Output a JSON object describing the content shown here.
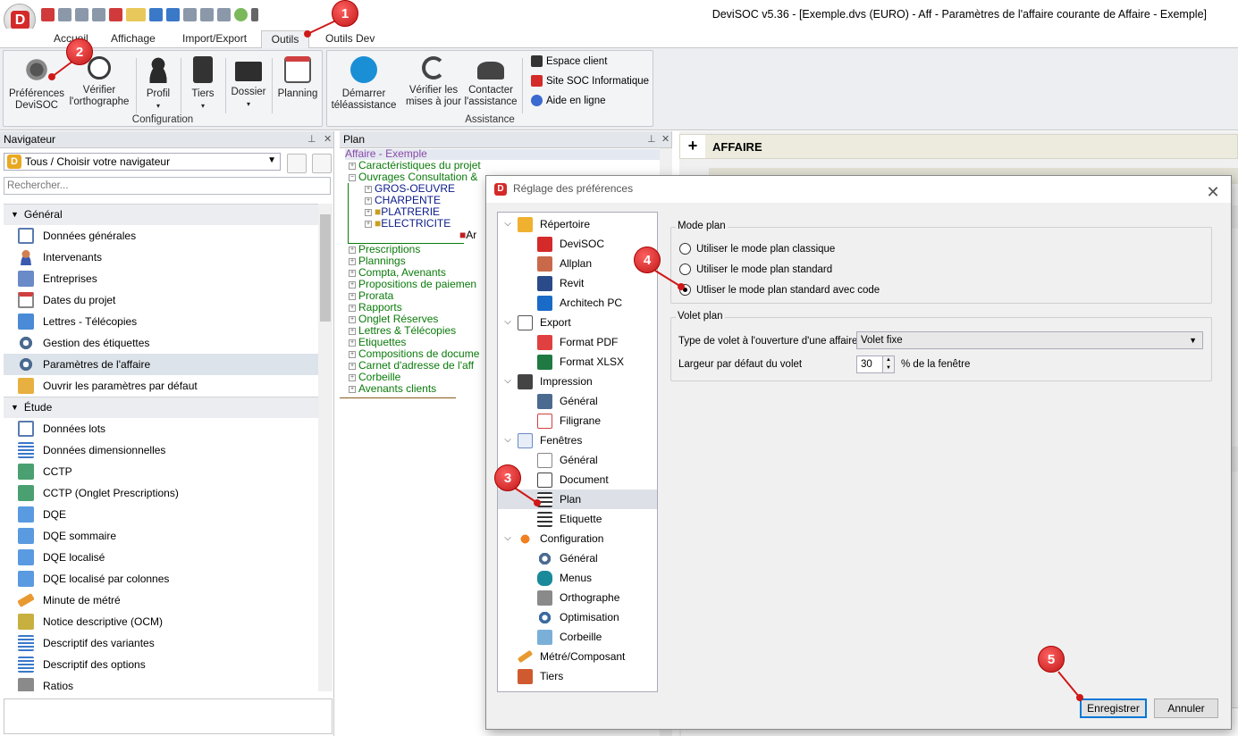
{
  "window": {
    "title": "DeviSOC v5.36 - [Exemple.dvs (EURO) - Aff - Paramètres de l'affaire courante de Affaire - Exemple]",
    "logo": "D"
  },
  "ribbon_tabs": [
    "Accueil",
    "Affichage",
    "Import/Export",
    "Outils",
    "Outils Dev"
  ],
  "active_tab": "Outils",
  "ribbon": {
    "config": {
      "label": "Configuration",
      "buttons": [
        {
          "label": "Préférences\nDeviSOC",
          "icon": "gears-icon"
        },
        {
          "label": "Vérifier\nl'orthographe",
          "icon": "check-icon"
        },
        {
          "label": "Profil",
          "icon": "person-icon"
        },
        {
          "label": "Tiers",
          "icon": "contacts-icon"
        },
        {
          "label": "Dossier",
          "icon": "folder-icon"
        },
        {
          "label": "Planning",
          "icon": "calendar-icon"
        }
      ]
    },
    "assist": {
      "label": "Assistance",
      "buttons": [
        {
          "label": "Démarrer\ntéléassistance",
          "icon": "teamviewer-icon"
        },
        {
          "label": "Vérifier les\nmises à jour",
          "icon": "sync-icon"
        },
        {
          "label": "Contacter\nl'assistance",
          "icon": "phone-icon"
        }
      ]
    },
    "links": [
      "Espace client",
      "Site SOC Informatique",
      "Aide en ligne"
    ]
  },
  "navigator": {
    "title": "Navigateur",
    "selector": "Tous / Choisir votre navigateur",
    "search_placeholder": "Rechercher...",
    "sections": [
      {
        "label": "Général",
        "items": [
          "Données générales",
          "Intervenants",
          "Entreprises",
          "Dates du projet",
          "Lettres - Télécopies",
          "Gestion des étiquettes",
          "Paramètres de l'affaire",
          "Ouvrir les paramètres par défaut"
        ]
      },
      {
        "label": "Étude",
        "items": [
          "Données lots",
          "Données dimensionnelles",
          "CCTP",
          "CCTP (Onglet Prescriptions)",
          "DQE",
          "DQE sommaire",
          "DQE localisé",
          "DQE localisé par colonnes",
          "Minute de métré",
          "Notice descriptive (OCM)",
          "Descriptif des variantes",
          "Descriptif des options",
          "Ratios"
        ]
      }
    ],
    "selected": "Paramètres de l'affaire"
  },
  "plan": {
    "title": "Plan",
    "root": "Affaire - Exemple",
    "items": [
      "Caractéristiques du projet",
      "Ouvrages Consultation &",
      "GROS-OEUVRE",
      "CHARPENTE",
      "PLATRERIE",
      "ELECTRICITE",
      "Ar",
      "Prescriptions",
      "Plannings",
      "Compta, Avenants",
      "Propositions de paiemen",
      "Prorata",
      "Rapports",
      "Onglet Réserves",
      "Lettres & Télécopies",
      "Etiquettes",
      "Compositions de docume",
      "Carnet d'adresse de l'aff",
      "Corbeille",
      "Avenants clients"
    ]
  },
  "right": {
    "header": "AFFAIRE",
    "plus": "+"
  },
  "dialog": {
    "title": "Réglage des préférences",
    "tree": [
      {
        "label": "Répertoire",
        "level": 0
      },
      {
        "label": "DeviSOC",
        "level": 1
      },
      {
        "label": "Allplan",
        "level": 1
      },
      {
        "label": "Revit",
        "level": 1
      },
      {
        "label": "Architech PC",
        "level": 1
      },
      {
        "label": "Export",
        "level": 0
      },
      {
        "label": "Format PDF",
        "level": 1
      },
      {
        "label": "Format XLSX",
        "level": 1
      },
      {
        "label": "Impression",
        "level": 0
      },
      {
        "label": "Général",
        "level": 1
      },
      {
        "label": "Filigrane",
        "level": 1
      },
      {
        "label": "Fenêtres",
        "level": 0
      },
      {
        "label": "Général",
        "level": 1
      },
      {
        "label": "Document",
        "level": 1
      },
      {
        "label": "Plan",
        "level": 1
      },
      {
        "label": "Etiquette",
        "level": 1
      },
      {
        "label": "Configuration",
        "level": 0
      },
      {
        "label": "Général",
        "level": 1
      },
      {
        "label": "Menus",
        "level": 1
      },
      {
        "label": "Orthographe",
        "level": 1
      },
      {
        "label": "Optimisation",
        "level": 1
      },
      {
        "label": "Corbeille",
        "level": 1
      },
      {
        "label": "Métré/Composant",
        "level": 0
      },
      {
        "label": "Tiers",
        "level": 0
      }
    ],
    "selected_tree": "Plan",
    "mode_plan": {
      "legend": "Mode plan",
      "options": [
        "Utiliser le mode plan classique",
        "Utiliser le mode plan standard",
        "Utliser le mode plan standard avec code"
      ],
      "selected_index": 2
    },
    "volet_plan": {
      "legend": "Volet plan",
      "type_label": "Type de volet à l'ouverture d'une affaire",
      "type_value": "Volet fixe",
      "width_label": "Largeur par défaut du volet",
      "width_value": "30",
      "width_unit": "% de la fenêtre"
    },
    "buttons": {
      "save": "Enregistrer",
      "cancel": "Annuler"
    }
  },
  "markers": [
    "1",
    "2",
    "3",
    "4",
    "5"
  ]
}
